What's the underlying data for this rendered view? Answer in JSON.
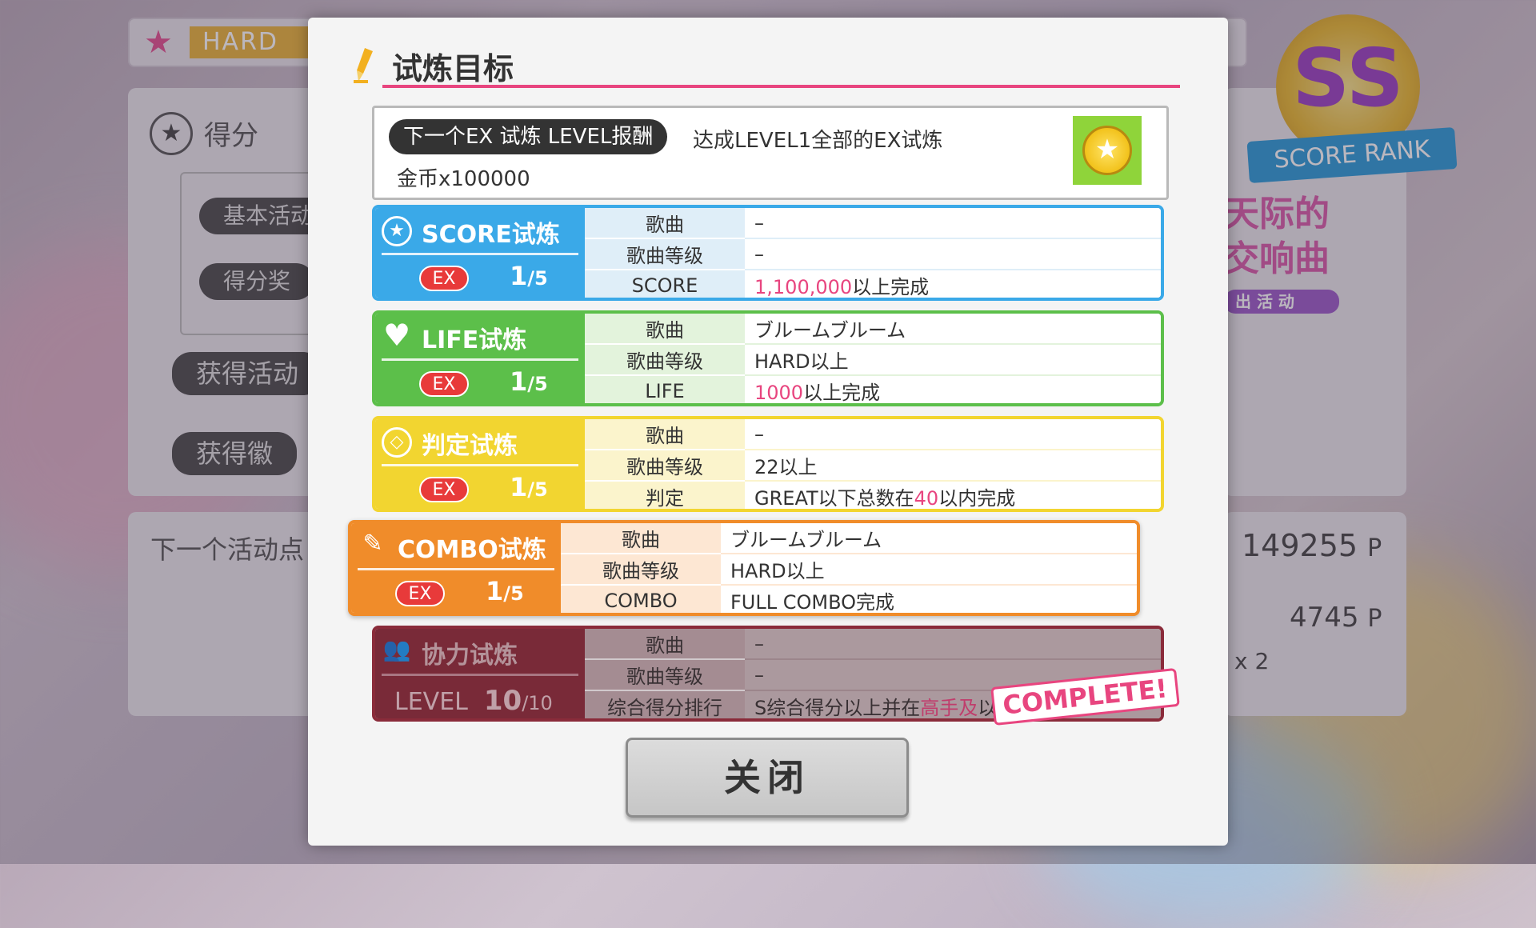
{
  "background": {
    "difficulty": "HARD",
    "section_title": "得分",
    "pill_1": "基本活动",
    "pill_2": "得分奖",
    "pill_3": "获得活动",
    "pill_4": "获得徽",
    "next_label": "下一个活动点",
    "points_1": "149255",
    "points_2": "4745",
    "unit": "P",
    "multiplier": "x 2",
    "rank_letters": "SS",
    "rank_label": "SCORE RANK",
    "event_title_1": "天际的",
    "event_title_2": "交响曲",
    "event_tag": "出 活 动"
  },
  "modal": {
    "title": "试炼目标",
    "reward": {
      "tag": "下一个EX 试炼 LEVEL报酬",
      "description": "达成LEVEL1全部的EX试炼",
      "gift": "金币x100000"
    },
    "ex_label": "EX",
    "trials": [
      {
        "name": "SCORE试炼",
        "progress": "1",
        "total": "/5",
        "rows": [
          {
            "key": "歌曲",
            "value": "–"
          },
          {
            "key": "歌曲等级",
            "value": "–"
          },
          {
            "key": "SCORE",
            "value_hl": "1,100,000",
            "value_rest": "以上完成"
          }
        ]
      },
      {
        "name": "LIFE试炼",
        "progress": "1",
        "total": "/5",
        "rows": [
          {
            "key": "歌曲",
            "value": "ブルームブルーム"
          },
          {
            "key": "歌曲等级",
            "value": "HARD以上"
          },
          {
            "key": "LIFE",
            "value_hl": "1000",
            "value_rest": "以上完成"
          }
        ]
      },
      {
        "name": "判定试炼",
        "progress": "1",
        "total": "/5",
        "rows": [
          {
            "key": "歌曲",
            "value": "–"
          },
          {
            "key": "歌曲等级",
            "value": "22以上"
          },
          {
            "key": "判定",
            "value_pre": "GREAT以下总数在",
            "value_hl": "40",
            "value_rest": "以内完成"
          }
        ]
      },
      {
        "name": "COMBO试炼",
        "progress": "1",
        "total": "/5",
        "rows": [
          {
            "key": "歌曲",
            "value": "ブルームブルーム"
          },
          {
            "key": "歌曲等级",
            "value": "HARD以上"
          },
          {
            "key": "COMBO",
            "value": "FULL COMBO完成"
          }
        ]
      },
      {
        "name": "协力试炼",
        "level_label": "LEVEL",
        "progress": "10",
        "total": "/10",
        "rows": [
          {
            "key": "歌曲",
            "value": "–"
          },
          {
            "key": "歌曲等级",
            "value": "–"
          },
          {
            "key": "综合得分排行",
            "value_pre": "S综合得分以上并在",
            "value_hl": "高手及",
            "value_rest": "以上完成"
          }
        ]
      }
    ],
    "complete_badge": "COMPLETE!",
    "close_button": "关闭"
  },
  "colors": {
    "score": "#3aa9e8",
    "life": "#5cbf4a",
    "judge": "#f2d530",
    "combo": "#f08c2a",
    "coop": "#8a2b3a",
    "accent": "#e8457f"
  }
}
